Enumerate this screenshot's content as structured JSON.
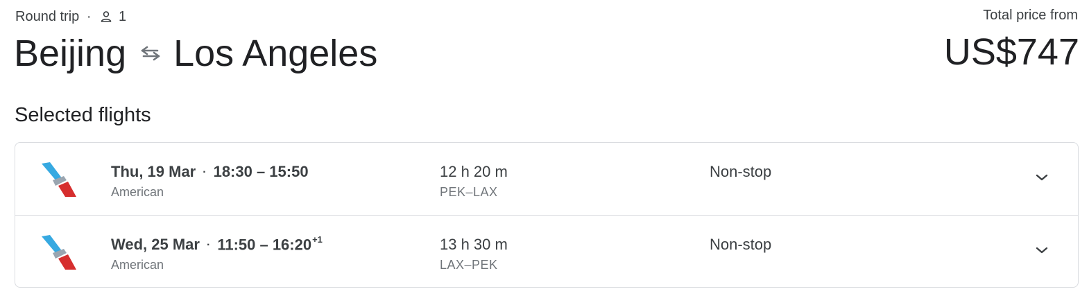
{
  "header": {
    "trip_type": "Round trip",
    "passengers": "1",
    "origin": "Beijing",
    "destination": "Los Angeles",
    "price_label": "Total price from",
    "price": "US$747"
  },
  "section_title": "Selected flights",
  "flights": [
    {
      "date": "Thu, 19 Mar",
      "times": "18:30 – 15:50",
      "day_offset": "",
      "airline": "American",
      "duration": "12 h 20 m",
      "route": "PEK–LAX",
      "stops": "Non-stop"
    },
    {
      "date": "Wed, 25 Mar",
      "times": "11:50 – 16:20",
      "day_offset": "+1",
      "airline": "American",
      "duration": "13 h 30 m",
      "route": "LAX–PEK",
      "stops": "Non-stop"
    }
  ],
  "colors": {
    "logo_blue": "#36a9e1",
    "logo_red": "#d62e2e",
    "logo_gray": "#9aa5b0",
    "border": "#dadce0"
  },
  "icons": {
    "passenger": "person-icon",
    "swap": "swap-arrows-icon",
    "expand": "chevron-down-icon"
  }
}
